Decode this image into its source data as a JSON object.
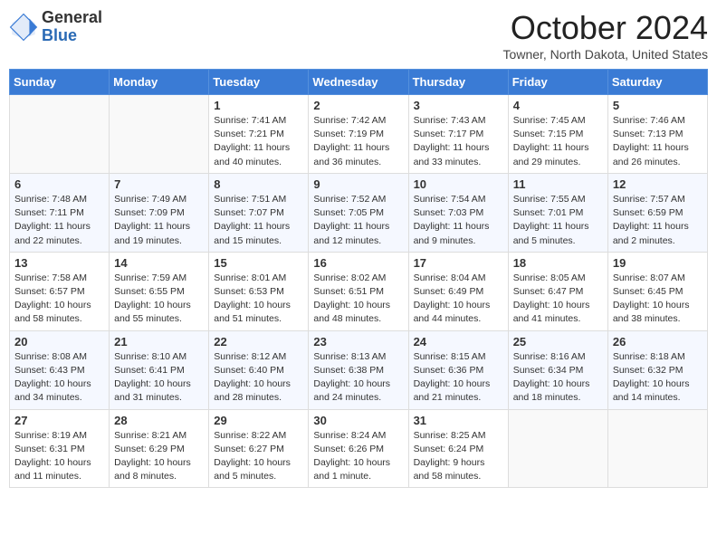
{
  "header": {
    "logo_general": "General",
    "logo_blue": "Blue",
    "month_title": "October 2024",
    "subtitle": "Towner, North Dakota, United States"
  },
  "weekdays": [
    "Sunday",
    "Monday",
    "Tuesday",
    "Wednesday",
    "Thursday",
    "Friday",
    "Saturday"
  ],
  "weeks": [
    [
      {
        "day": "",
        "sunrise": "",
        "sunset": "",
        "daylight": ""
      },
      {
        "day": "",
        "sunrise": "",
        "sunset": "",
        "daylight": ""
      },
      {
        "day": "1",
        "sunrise": "Sunrise: 7:41 AM",
        "sunset": "Sunset: 7:21 PM",
        "daylight": "Daylight: 11 hours and 40 minutes."
      },
      {
        "day": "2",
        "sunrise": "Sunrise: 7:42 AM",
        "sunset": "Sunset: 7:19 PM",
        "daylight": "Daylight: 11 hours and 36 minutes."
      },
      {
        "day": "3",
        "sunrise": "Sunrise: 7:43 AM",
        "sunset": "Sunset: 7:17 PM",
        "daylight": "Daylight: 11 hours and 33 minutes."
      },
      {
        "day": "4",
        "sunrise": "Sunrise: 7:45 AM",
        "sunset": "Sunset: 7:15 PM",
        "daylight": "Daylight: 11 hours and 29 minutes."
      },
      {
        "day": "5",
        "sunrise": "Sunrise: 7:46 AM",
        "sunset": "Sunset: 7:13 PM",
        "daylight": "Daylight: 11 hours and 26 minutes."
      }
    ],
    [
      {
        "day": "6",
        "sunrise": "Sunrise: 7:48 AM",
        "sunset": "Sunset: 7:11 PM",
        "daylight": "Daylight: 11 hours and 22 minutes."
      },
      {
        "day": "7",
        "sunrise": "Sunrise: 7:49 AM",
        "sunset": "Sunset: 7:09 PM",
        "daylight": "Daylight: 11 hours and 19 minutes."
      },
      {
        "day": "8",
        "sunrise": "Sunrise: 7:51 AM",
        "sunset": "Sunset: 7:07 PM",
        "daylight": "Daylight: 11 hours and 15 minutes."
      },
      {
        "day": "9",
        "sunrise": "Sunrise: 7:52 AM",
        "sunset": "Sunset: 7:05 PM",
        "daylight": "Daylight: 11 hours and 12 minutes."
      },
      {
        "day": "10",
        "sunrise": "Sunrise: 7:54 AM",
        "sunset": "Sunset: 7:03 PM",
        "daylight": "Daylight: 11 hours and 9 minutes."
      },
      {
        "day": "11",
        "sunrise": "Sunrise: 7:55 AM",
        "sunset": "Sunset: 7:01 PM",
        "daylight": "Daylight: 11 hours and 5 minutes."
      },
      {
        "day": "12",
        "sunrise": "Sunrise: 7:57 AM",
        "sunset": "Sunset: 6:59 PM",
        "daylight": "Daylight: 11 hours and 2 minutes."
      }
    ],
    [
      {
        "day": "13",
        "sunrise": "Sunrise: 7:58 AM",
        "sunset": "Sunset: 6:57 PM",
        "daylight": "Daylight: 10 hours and 58 minutes."
      },
      {
        "day": "14",
        "sunrise": "Sunrise: 7:59 AM",
        "sunset": "Sunset: 6:55 PM",
        "daylight": "Daylight: 10 hours and 55 minutes."
      },
      {
        "day": "15",
        "sunrise": "Sunrise: 8:01 AM",
        "sunset": "Sunset: 6:53 PM",
        "daylight": "Daylight: 10 hours and 51 minutes."
      },
      {
        "day": "16",
        "sunrise": "Sunrise: 8:02 AM",
        "sunset": "Sunset: 6:51 PM",
        "daylight": "Daylight: 10 hours and 48 minutes."
      },
      {
        "day": "17",
        "sunrise": "Sunrise: 8:04 AM",
        "sunset": "Sunset: 6:49 PM",
        "daylight": "Daylight: 10 hours and 44 minutes."
      },
      {
        "day": "18",
        "sunrise": "Sunrise: 8:05 AM",
        "sunset": "Sunset: 6:47 PM",
        "daylight": "Daylight: 10 hours and 41 minutes."
      },
      {
        "day": "19",
        "sunrise": "Sunrise: 8:07 AM",
        "sunset": "Sunset: 6:45 PM",
        "daylight": "Daylight: 10 hours and 38 minutes."
      }
    ],
    [
      {
        "day": "20",
        "sunrise": "Sunrise: 8:08 AM",
        "sunset": "Sunset: 6:43 PM",
        "daylight": "Daylight: 10 hours and 34 minutes."
      },
      {
        "day": "21",
        "sunrise": "Sunrise: 8:10 AM",
        "sunset": "Sunset: 6:41 PM",
        "daylight": "Daylight: 10 hours and 31 minutes."
      },
      {
        "day": "22",
        "sunrise": "Sunrise: 8:12 AM",
        "sunset": "Sunset: 6:40 PM",
        "daylight": "Daylight: 10 hours and 28 minutes."
      },
      {
        "day": "23",
        "sunrise": "Sunrise: 8:13 AM",
        "sunset": "Sunset: 6:38 PM",
        "daylight": "Daylight: 10 hours and 24 minutes."
      },
      {
        "day": "24",
        "sunrise": "Sunrise: 8:15 AM",
        "sunset": "Sunset: 6:36 PM",
        "daylight": "Daylight: 10 hours and 21 minutes."
      },
      {
        "day": "25",
        "sunrise": "Sunrise: 8:16 AM",
        "sunset": "Sunset: 6:34 PM",
        "daylight": "Daylight: 10 hours and 18 minutes."
      },
      {
        "day": "26",
        "sunrise": "Sunrise: 8:18 AM",
        "sunset": "Sunset: 6:32 PM",
        "daylight": "Daylight: 10 hours and 14 minutes."
      }
    ],
    [
      {
        "day": "27",
        "sunrise": "Sunrise: 8:19 AM",
        "sunset": "Sunset: 6:31 PM",
        "daylight": "Daylight: 10 hours and 11 minutes."
      },
      {
        "day": "28",
        "sunrise": "Sunrise: 8:21 AM",
        "sunset": "Sunset: 6:29 PM",
        "daylight": "Daylight: 10 hours and 8 minutes."
      },
      {
        "day": "29",
        "sunrise": "Sunrise: 8:22 AM",
        "sunset": "Sunset: 6:27 PM",
        "daylight": "Daylight: 10 hours and 5 minutes."
      },
      {
        "day": "30",
        "sunrise": "Sunrise: 8:24 AM",
        "sunset": "Sunset: 6:26 PM",
        "daylight": "Daylight: 10 hours and 1 minute."
      },
      {
        "day": "31",
        "sunrise": "Sunrise: 8:25 AM",
        "sunset": "Sunset: 6:24 PM",
        "daylight": "Daylight: 9 hours and 58 minutes."
      },
      {
        "day": "",
        "sunrise": "",
        "sunset": "",
        "daylight": ""
      },
      {
        "day": "",
        "sunrise": "",
        "sunset": "",
        "daylight": ""
      }
    ]
  ]
}
